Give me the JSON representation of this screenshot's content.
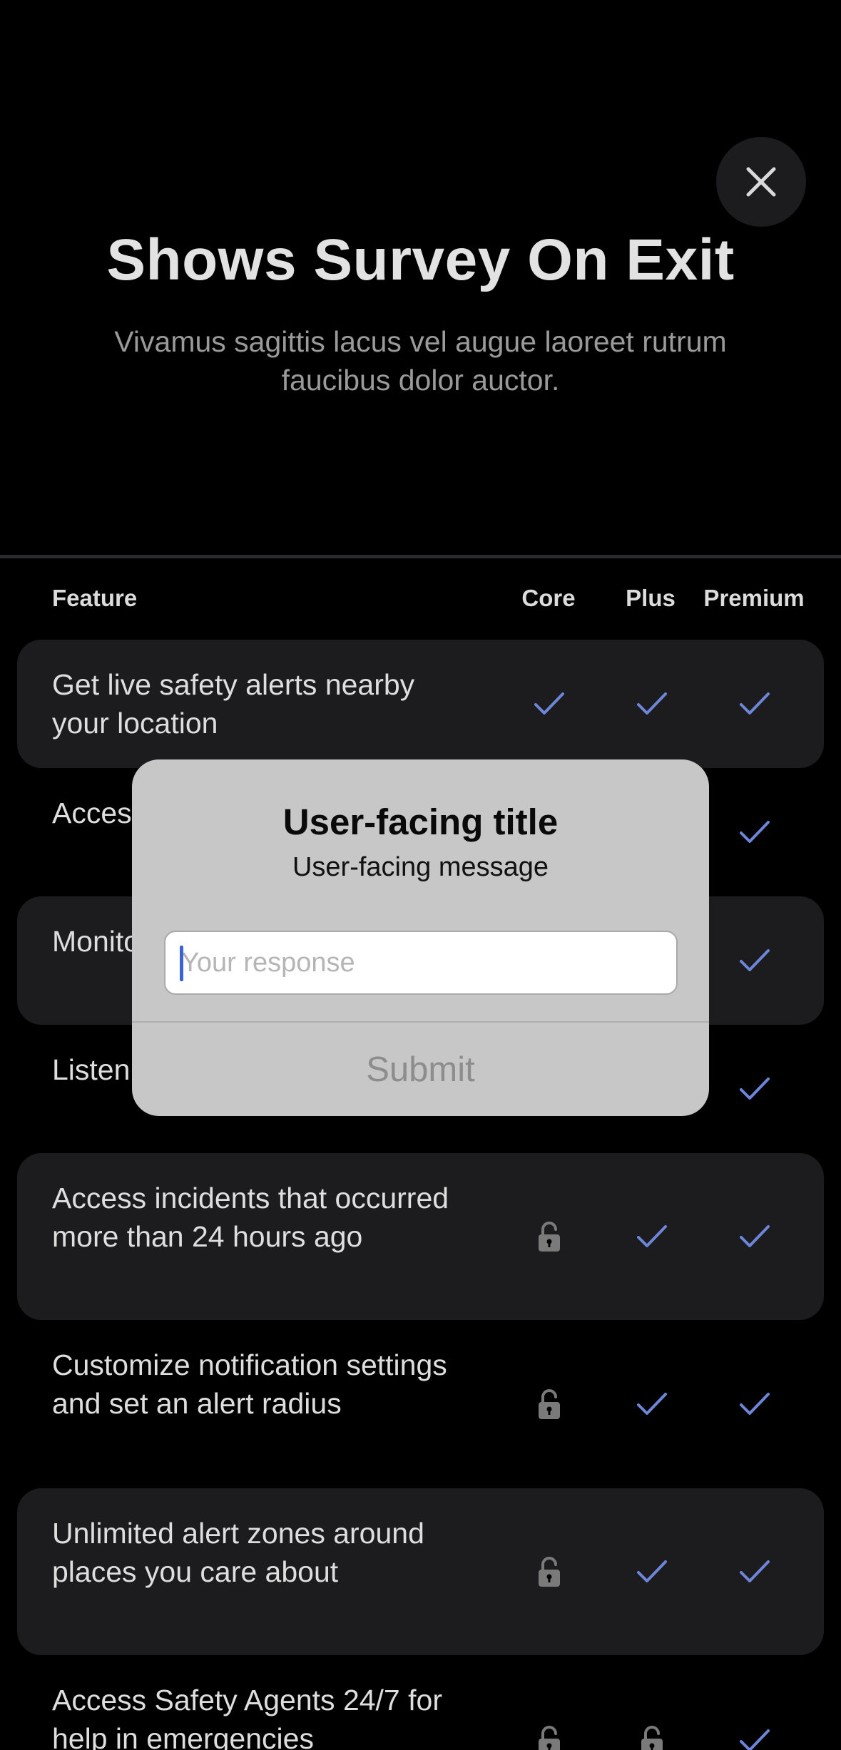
{
  "header": {
    "title": "Shows Survey On Exit",
    "subtitle": "Vivamus sagittis lacus vel augue laoreet rutrum faucibus dolor auctor."
  },
  "table": {
    "columns": [
      "Feature",
      "Core",
      "Plus",
      "Premium"
    ],
    "rows": [
      {
        "label": "Get live safety alerts nearby your location",
        "core": "check",
        "plus": "check",
        "premium": "check"
      },
      {
        "label": "Access incidents that occurred",
        "core": "check",
        "plus": "check",
        "premium": "check"
      },
      {
        "label": "Monitor safety",
        "core": "check",
        "plus": "check",
        "premium": "check"
      },
      {
        "label": "Listen to radio clips",
        "core": "check",
        "plus": "check",
        "premium": "check"
      },
      {
        "label": "Access incidents that occurred more than 24 hours ago",
        "core": "lock",
        "plus": "check",
        "premium": "check"
      },
      {
        "label": "Customize notification settings and set an alert radius",
        "core": "lock",
        "plus": "check",
        "premium": "check"
      },
      {
        "label": "Unlimited alert zones around places you care about",
        "core": "lock",
        "plus": "check",
        "premium": "check"
      },
      {
        "label": "Access Safety Agents 24/7 for help in emergencies",
        "core": "lock",
        "plus": "lock",
        "premium": "check"
      }
    ]
  },
  "alert": {
    "title": "User-facing title",
    "message": "User-facing message",
    "input_placeholder": "Your response",
    "input_value": "",
    "submit_label": "Submit"
  },
  "colors": {
    "background": "#000000",
    "row_shade": "#1c1c1e",
    "check": "#6d86d9",
    "lock": "#7a7a7a",
    "alert_bg": "#c7c7c7",
    "caret": "#3a63d9"
  },
  "icons": {
    "close": "close-icon",
    "check": "checkmark-icon",
    "lock": "lock-icon"
  }
}
